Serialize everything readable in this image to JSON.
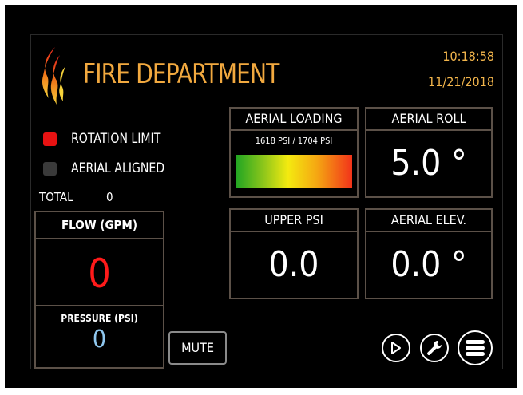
{
  "header": {
    "title": "FIRE DEPARTMENT",
    "time": "10:18:58",
    "date": "11/21/2018"
  },
  "colors": {
    "accent": "#f2a93f",
    "rotation_indicator": "#e81212",
    "aligned_indicator": "#3a3a3a",
    "flow_value": "#ff1a1a",
    "pressure_value": "#8fc7ee"
  },
  "indicators": [
    {
      "label": "ROTATION LIMIT",
      "state": "active"
    },
    {
      "label": "AERIAL ALIGNED",
      "state": "inactive"
    }
  ],
  "total": {
    "label": "TOTAL",
    "value": "0"
  },
  "flow": {
    "title": "FLOW (GPM)",
    "value": "0"
  },
  "pressure": {
    "title": "PRESSURE (PSI)",
    "value": "0"
  },
  "aerial_loading": {
    "title": "AERIAL LOADING",
    "readout": "1618 PSI / 1704 PSI",
    "level": 0.95
  },
  "aerial_roll": {
    "title": "AERIAL ROLL",
    "value": "5.0 °"
  },
  "upper_psi": {
    "title": "UPPER PSI",
    "value": "0.0"
  },
  "aerial_elev": {
    "title": "AERIAL ELEV.",
    "value": "0.0 °"
  },
  "buttons": {
    "mute": "MUTE"
  },
  "icons": {
    "play": "play-icon",
    "settings": "wrench-icon",
    "menu": "menu-icon",
    "logo": "flame-icon"
  }
}
